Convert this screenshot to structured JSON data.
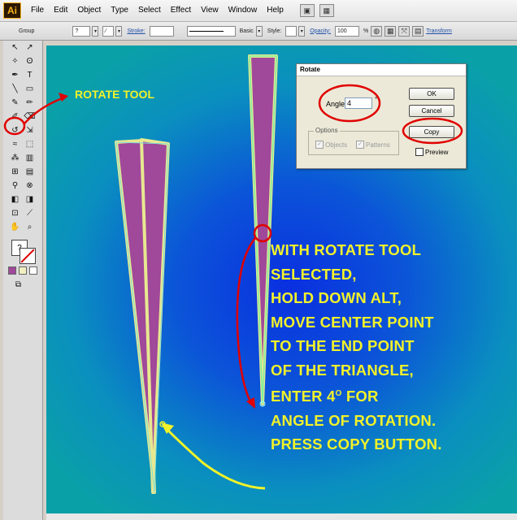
{
  "menubar": {
    "logo": "Ai",
    "items": [
      "File",
      "Edit",
      "Object",
      "Type",
      "Select",
      "Effect",
      "View",
      "Window",
      "Help"
    ]
  },
  "control_bar": {
    "selection": "Group",
    "stroke_label": "Stroke:",
    "brush_name": "Basic",
    "style_label": "Style:",
    "opacity_label": "Opacity:",
    "opacity_value": "100",
    "opacity_unit": "%",
    "transform_label": "Transform"
  },
  "annotations": {
    "rotate_tool": "ROTATE TOOL",
    "instructions": [
      "WITH ROTATE TOOL",
      "SELECTED,",
      "HOLD DOWN ALT,",
      "MOVE CENTER POINT",
      "TO THE END POINT",
      "OF THE TRIANGLE,",
      "ENTER 4",
      "ANGLE OF ROTATION.",
      "PRESS COPY BUTTON."
    ],
    "degree_mark": "O",
    "enter_suffix": " FOR"
  },
  "rotate_dialog": {
    "title": "Rotate",
    "angle_label": "Angle:",
    "angle_value": "4",
    "degree_symbol": "°",
    "ok_label": "OK",
    "cancel_label": "Cancel",
    "copy_label": "Copy",
    "options_title": "Options",
    "objects_label": "Objects",
    "patterns_label": "Patterns",
    "preview_label": "Preview"
  },
  "colors": {
    "annotation_yellow": "#f2f22a",
    "highlight_red": "#e00000",
    "triangle_fill": "#a0489a",
    "triangle_edge": "#e8e890"
  }
}
